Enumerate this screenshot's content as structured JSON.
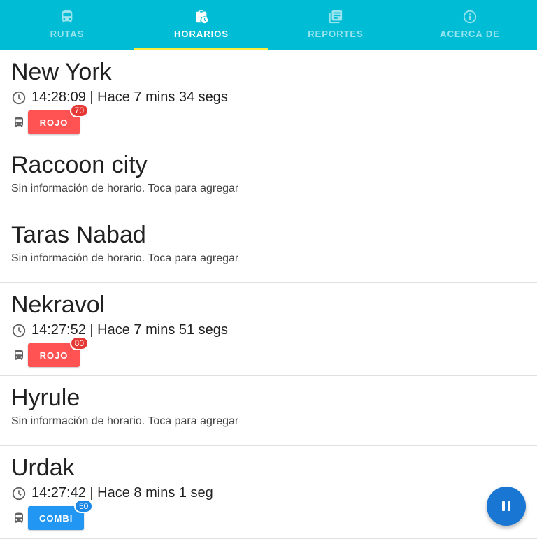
{
  "tabs": [
    {
      "label": "RUTAS",
      "icon": "bus-icon",
      "active": false
    },
    {
      "label": "HORARIOS",
      "icon": "schedule-clipboard-icon",
      "active": true
    },
    {
      "label": "REPORTES",
      "icon": "reports-library-icon",
      "active": false
    },
    {
      "label": "ACERCA DE",
      "icon": "info-icon",
      "active": false
    }
  ],
  "colors": {
    "appbar": "#00BCD4",
    "indicator": "#FFEB3B",
    "rojo": "#FF5252",
    "rojo_badge": "#E53935",
    "combi": "#2196F3",
    "combi_badge": "#1E88E5",
    "fab": "#1976D2"
  },
  "stops": [
    {
      "name": "New York",
      "time": "14:28:09",
      "ago": "Hace 7 mins 34 segs",
      "route": "ROJO",
      "count": "70"
    },
    {
      "name": "Raccoon city",
      "empty_text": "Sin información de horario. Toca para agregar"
    },
    {
      "name": "Taras Nabad",
      "empty_text": "Sin información de horario. Toca para agregar"
    },
    {
      "name": "Nekravol",
      "time": "14:27:52",
      "ago": "Hace 7 mins 51 segs",
      "route": "ROJO",
      "count": "80"
    },
    {
      "name": "Hyrule",
      "empty_text": "Sin información de horario. Toca para agregar"
    },
    {
      "name": "Urdak",
      "time": "14:27:42",
      "ago": "Hace 8 mins 1 seg",
      "route": "COMBI",
      "count": "50"
    }
  ],
  "fab": {
    "icon": "pause-icon"
  }
}
